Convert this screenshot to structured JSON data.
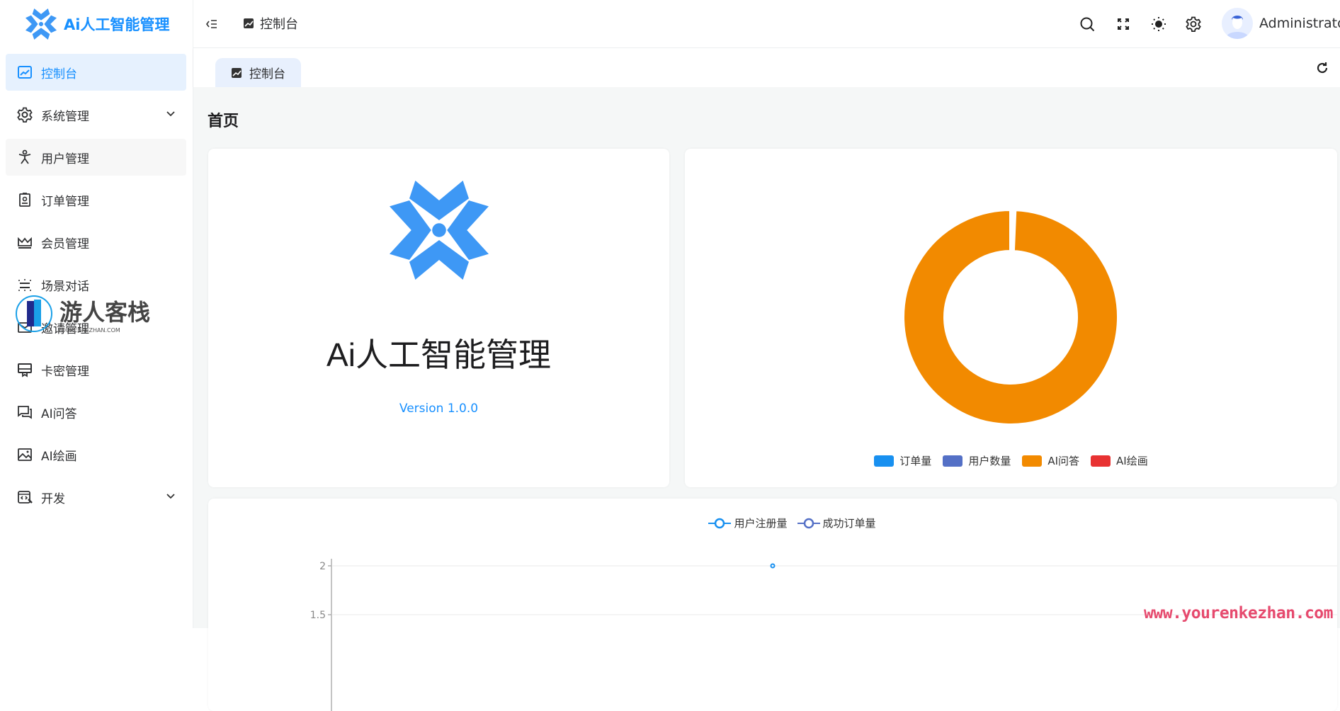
{
  "app": {
    "title": "Ai人工智能管理"
  },
  "sidebar": {
    "items": [
      {
        "label": "控制台",
        "icon": "chart-icon",
        "active": true
      },
      {
        "label": "系统管理",
        "icon": "gear-icon",
        "expandable": true
      },
      {
        "label": "用户管理",
        "icon": "user-icon"
      },
      {
        "label": "订单管理",
        "icon": "badge-icon"
      },
      {
        "label": "会员管理",
        "icon": "crown-icon"
      },
      {
        "label": "场景对话",
        "icon": "scene-icon"
      },
      {
        "label": "邀请管理",
        "icon": "mail-icon"
      },
      {
        "label": "卡密管理",
        "icon": "card-icon"
      },
      {
        "label": "AI问答",
        "icon": "chat-icon"
      },
      {
        "label": "AI绘画",
        "icon": "image-icon"
      },
      {
        "label": "开发",
        "icon": "code-icon",
        "expandable": true
      }
    ]
  },
  "header": {
    "breadcrumb": "控制台",
    "user": "Administrator"
  },
  "tabs": [
    {
      "label": "控制台"
    }
  ],
  "page": {
    "title": "首页"
  },
  "intro": {
    "title": "Ai人工智能管理",
    "version": "Version 1.0.0"
  },
  "colors": {
    "accent": "#1890ff",
    "order": "#1890f0",
    "users": "#5470c6",
    "aiqa": "#f28a00",
    "aidraw": "#e83232"
  },
  "chart_data": [
    {
      "type": "pie",
      "donut": true,
      "legend_position": "bottom",
      "legend": [
        "订单量",
        "用户数量",
        "AI问答",
        "AI绘画"
      ],
      "series": [
        {
          "name": "订单量",
          "value": 1,
          "color": "#1890f0"
        },
        {
          "name": "用户数量",
          "value": 1,
          "color": "#5470c6"
        },
        {
          "name": "AI问答",
          "value": 300,
          "color": "#f28a00"
        },
        {
          "name": "AI绘画",
          "value": 0,
          "color": "#e83232"
        }
      ]
    },
    {
      "type": "line",
      "legend_position": "top",
      "legend": [
        "用户注册量",
        "成功订单量"
      ],
      "y_ticks": [
        "2",
        "1.5"
      ],
      "series": [
        {
          "name": "用户注册量",
          "values": [
            2
          ],
          "color": "#1890f0"
        },
        {
          "name": "成功订单量",
          "values": [],
          "color": "#5470c6"
        }
      ],
      "grid": true
    }
  ],
  "watermark": {
    "logo": "游人客栈",
    "logo_sub": "YOURENKEZHAN.COM",
    "url": "www.yourenkezhan.com"
  }
}
